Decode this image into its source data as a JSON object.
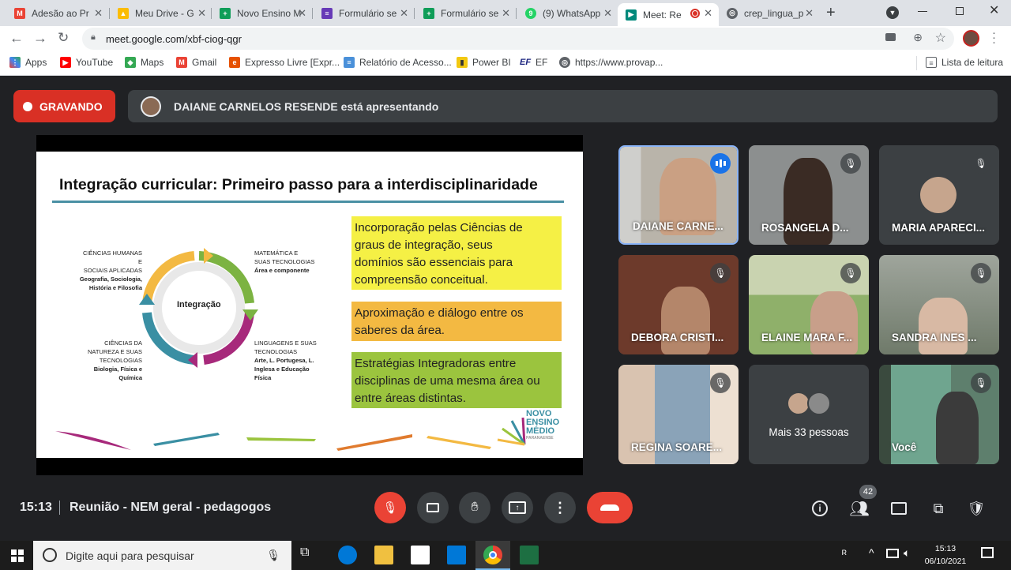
{
  "tabs": [
    {
      "title": "Adesão ao Pr",
      "icon": "gmail-icon",
      "color": "#ea4335"
    },
    {
      "title": "Meu Drive - G",
      "icon": "drive-icon",
      "color": "#fbbc04"
    },
    {
      "title": "Novo Ensino M",
      "icon": "sheets-icon",
      "color": "#0f9d58"
    },
    {
      "title": "Formulário se",
      "icon": "forms-icon",
      "color": "#673ab7"
    },
    {
      "title": "Formulário se",
      "icon": "sheets-icon",
      "color": "#0f9d58"
    },
    {
      "title": "(9) WhatsApp",
      "icon": "whatsapp-icon",
      "color": "#25d366"
    },
    {
      "title": "Meet: Re",
      "icon": "meet-icon",
      "color": "#00897b"
    },
    {
      "title": "crep_lingua_p",
      "icon": "globe-icon",
      "color": "#5f6368"
    }
  ],
  "url": "meet.google.com/xbf-ciog-qgr",
  "bookmarks": [
    {
      "label": "Apps",
      "icon": "apps-icon",
      "color": "#4285f4"
    },
    {
      "label": "YouTube",
      "icon": "youtube-icon",
      "color": "#ff0000"
    },
    {
      "label": "Maps",
      "icon": "maps-icon",
      "color": "#34a853"
    },
    {
      "label": "Gmail",
      "icon": "gmail-icon",
      "color": "#ea4335"
    },
    {
      "label": "Expresso Livre [Expr...",
      "icon": "expresso-icon",
      "color": "#e65100"
    },
    {
      "label": "Relatório de Acesso...",
      "icon": "report-icon",
      "color": "#4a90d9"
    },
    {
      "label": "Power BI",
      "icon": "powerbi-icon",
      "color": "#f2c811"
    },
    {
      "label": "EF",
      "icon": "ef-icon",
      "color": "#1a237e"
    },
    {
      "label": "https://www.provap...",
      "icon": "globe-icon",
      "color": "#5f6368"
    }
  ],
  "reading_list": "Lista de leitura",
  "recording": "GRAVANDO",
  "presenter_text": "DAIANE CARNELOS RESENDE está apresentando",
  "slide": {
    "title": "Integração curricular: Primeiro passo para a interdisciplinaridade",
    "center": "Integração",
    "labels": {
      "humanas_1": "CIÊNCIAS HUMANAS E",
      "humanas_2": "SOCIAIS APLICADAS",
      "humanas_3": "Geografia, Sociologia,",
      "humanas_4": "História e Filosofia",
      "mat_1": "MATEMÁTICA E",
      "mat_2": "SUAS TECNOLOGIAS",
      "mat_3": "Área e componente",
      "nat_1": "CIÊNCIAS DA",
      "nat_2": "NATUREZA E SUAS",
      "nat_3": "TECNOLOGIAS",
      "nat_4": "Biologia, Física e",
      "nat_5": "Química",
      "ling_1": "LINGUAGENS E SUAS",
      "ling_2": "TECNOLOGIAS",
      "ling_3": "Arte, L. Portugesa, L.",
      "ling_4": "Inglesa e Educação",
      "ling_5": "Física"
    },
    "box1_l1": "Incorporação pelas Ciências de",
    "box1_l2": "graus de integração, seus",
    "box1_l3": "domínios são essenciais para",
    "box1_l4": "compreensão conceitual.",
    "box2_l1": "Aproximação e diálogo entre os",
    "box2_l2": "saberes da área.",
    "box3_l1": "Estratégias Integradoras entre",
    "box3_l2": "disciplinas de uma mesma área ou",
    "box3_l3": "entre áreas distintas.",
    "logo_1": "NOVO",
    "logo_2": "ENSINO",
    "logo_3": "MÉDIO",
    "logo_4": "PARANAENSE"
  },
  "participants": [
    {
      "name": "DAIANE CARNE...",
      "speaking": true
    },
    {
      "name": "ROSANGELA D...",
      "muted": true
    },
    {
      "name": "MARIA APARECI...",
      "muted": true
    },
    {
      "name": "DEBORA CRISTI...",
      "muted": true
    },
    {
      "name": "ELAINE MARA F...",
      "muted": true
    },
    {
      "name": "SANDRA INES ...",
      "muted": true
    },
    {
      "name": "REGINA SOARE...",
      "muted": true
    },
    {
      "name": "Mais 33 pessoas"
    },
    {
      "name": "Você",
      "muted": true
    }
  ],
  "meeting": {
    "time": "15:13",
    "name": "Reunião - NEM geral - pedagogos",
    "participant_count": "42"
  },
  "taskbar": {
    "search": "Digite aqui para pesquisar",
    "time": "15:13",
    "date": "06/10/2021"
  }
}
